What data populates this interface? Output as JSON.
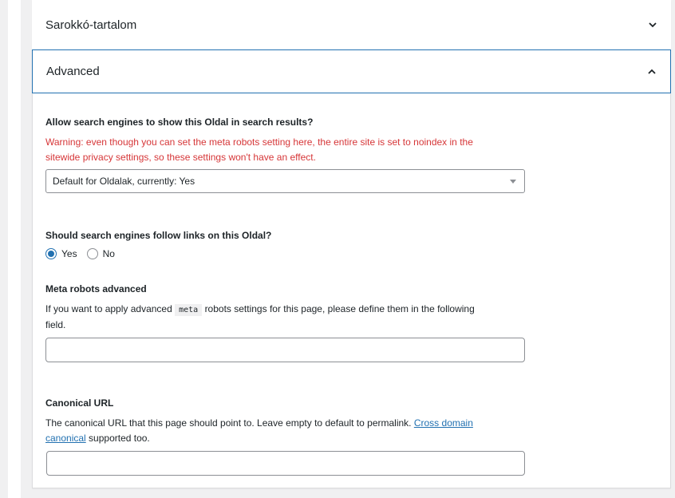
{
  "sections": {
    "sarokko": {
      "title": "Sarokkó-tartalom",
      "icon": "chevron-down-icon"
    },
    "advanced": {
      "title": "Advanced",
      "icon": "chevron-up-icon"
    }
  },
  "search_visibility": {
    "label": "Allow search engines to show this Oldal in search results?",
    "warning_line1": "Warning: even though you can set the meta robots setting here, the entire site is set to noindex in the",
    "warning_line2": "sitewide privacy settings, so these settings won't have an effect.",
    "select_value": "Default for Oldalak, currently: Yes"
  },
  "follow_links": {
    "label": "Should search engines follow links on this Oldal?",
    "options": [
      "Yes",
      "No"
    ],
    "selected": "Yes"
  },
  "meta_robots": {
    "label": "Meta robots advanced",
    "desc_before": "If you want to apply advanced",
    "desc_code": "meta",
    "desc_after": "robots settings for this page, please define them in the following",
    "desc_line2": "field.",
    "value": ""
  },
  "canonical": {
    "label": "Canonical URL",
    "desc_before": "The canonical URL that this page should point to. Leave empty to default to permalink.",
    "link_part1": "Cross domain",
    "link_part2": "canonical",
    "desc_after": "supported too.",
    "value": ""
  },
  "colors": {
    "accent": "#2271b1",
    "warning": "#d63638",
    "border": "#dcdcde"
  }
}
